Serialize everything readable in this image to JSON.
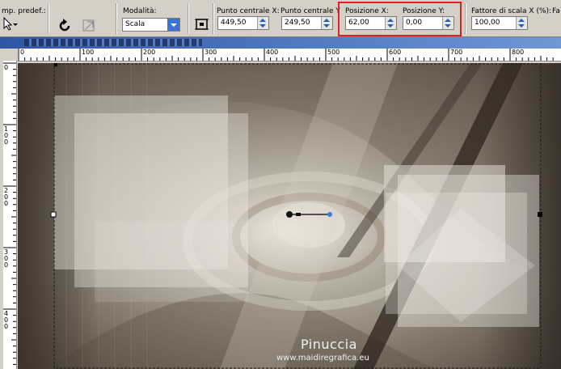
{
  "toolbar": {
    "preset_label": "mp. predef.:",
    "mode_label": "Modalità:",
    "mode_value": "Scala",
    "center_x_label": "Punto centrale X:",
    "center_x_value": "449,50",
    "center_y_label": "Punto centrale Y",
    "center_y_value": "249,50",
    "pos_x_label": "Posizione X:",
    "pos_x_value": "62,00",
    "pos_y_label": "Posizione Y:",
    "pos_y_value": "0,00",
    "scale_x_label": "Fattore di scala X (%):",
    "scale_x_value": "100,00",
    "truncated_label": "Fa",
    "highlight_color": "#e02020"
  },
  "ruler": {
    "h_ticks": [
      "0",
      "100",
      "200",
      "300",
      "400",
      "500",
      "600",
      "700",
      "800"
    ],
    "v_ticks": [
      "0",
      "1 0 0",
      "2 0 0",
      "3 0 0",
      "4 0 0"
    ]
  },
  "canvas": {
    "watermark_title": "Pinuccia",
    "watermark_url": "www.maidiregrafica.eu"
  },
  "icons": {
    "preset": "arrow-cursor-icon",
    "rotate": "rotate-icon",
    "reset": "reset-transform-icon",
    "pick": "pick-tool-icon"
  }
}
